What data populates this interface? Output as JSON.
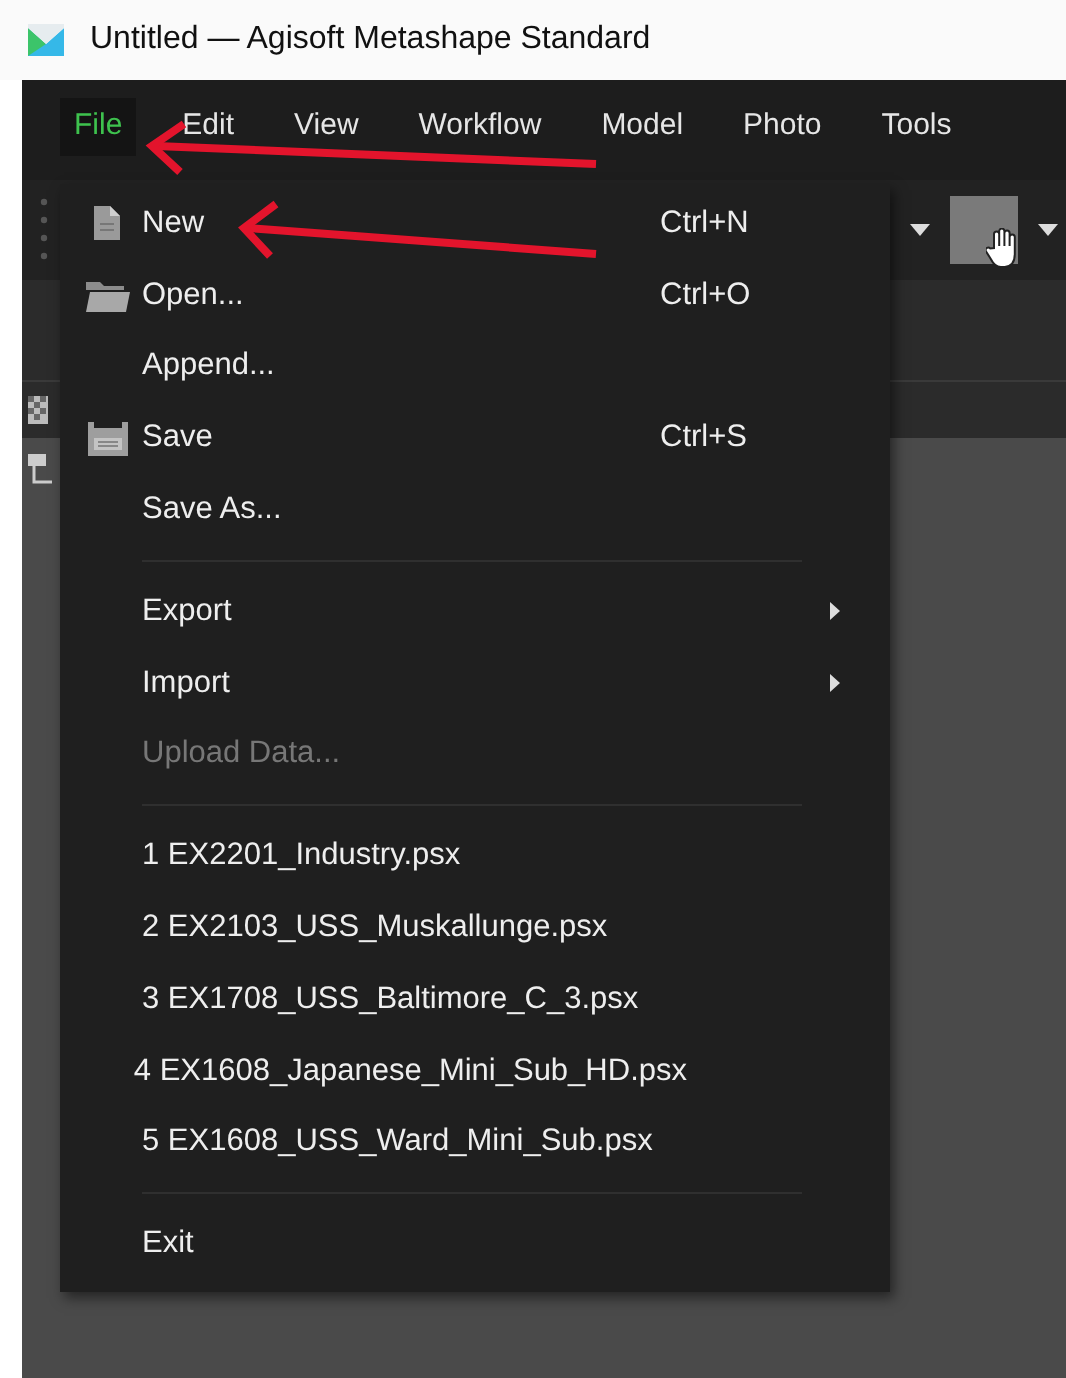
{
  "window": {
    "title": "Untitled — Agisoft Metashape Standard"
  },
  "menubar": [
    {
      "label": "File",
      "selected": true
    },
    {
      "label": "Edit",
      "selected": false
    },
    {
      "label": "View",
      "selected": false
    },
    {
      "label": "Workflow",
      "selected": false
    },
    {
      "label": "Model",
      "selected": false
    },
    {
      "label": "Photo",
      "selected": false
    },
    {
      "label": "Tools",
      "selected": false
    }
  ],
  "file_menu": [
    {
      "kind": "command",
      "label": "New",
      "shortcut": "Ctrl+N",
      "disabled": false
    },
    {
      "kind": "command",
      "label": "Open...",
      "shortcut": "Ctrl+O",
      "disabled": false
    },
    {
      "kind": "command",
      "label": "Append...",
      "disabled": false
    },
    {
      "kind": "command",
      "label": "Save",
      "shortcut": "Ctrl+S",
      "disabled": false
    },
    {
      "kind": "command",
      "label": "Save As...",
      "disabled": false
    },
    {
      "kind": "separator"
    },
    {
      "kind": "submenu",
      "label": "Export",
      "disabled": false
    },
    {
      "kind": "submenu",
      "label": "Import",
      "disabled": false
    },
    {
      "kind": "command",
      "label": "Upload Data...",
      "disabled": true
    },
    {
      "kind": "separator"
    },
    {
      "kind": "command",
      "label": "1 EX2201_Industry.psx",
      "disabled": false
    },
    {
      "kind": "command",
      "label": "2 EX2103_USS_Muskallunge.psx",
      "disabled": false
    },
    {
      "kind": "command",
      "label": "3 EX1708_USS_Baltimore_C_3.psx",
      "disabled": false
    },
    {
      "kind": "command",
      "label": "4 EX1608_Japanese_Mini_Sub_HD.psx",
      "disabled": false
    },
    {
      "kind": "command",
      "label": "5 EX1608_USS_Ward_Mini_Sub.psx",
      "disabled": false
    },
    {
      "kind": "separator"
    },
    {
      "kind": "command",
      "label": "Exit",
      "disabled": false
    }
  ]
}
